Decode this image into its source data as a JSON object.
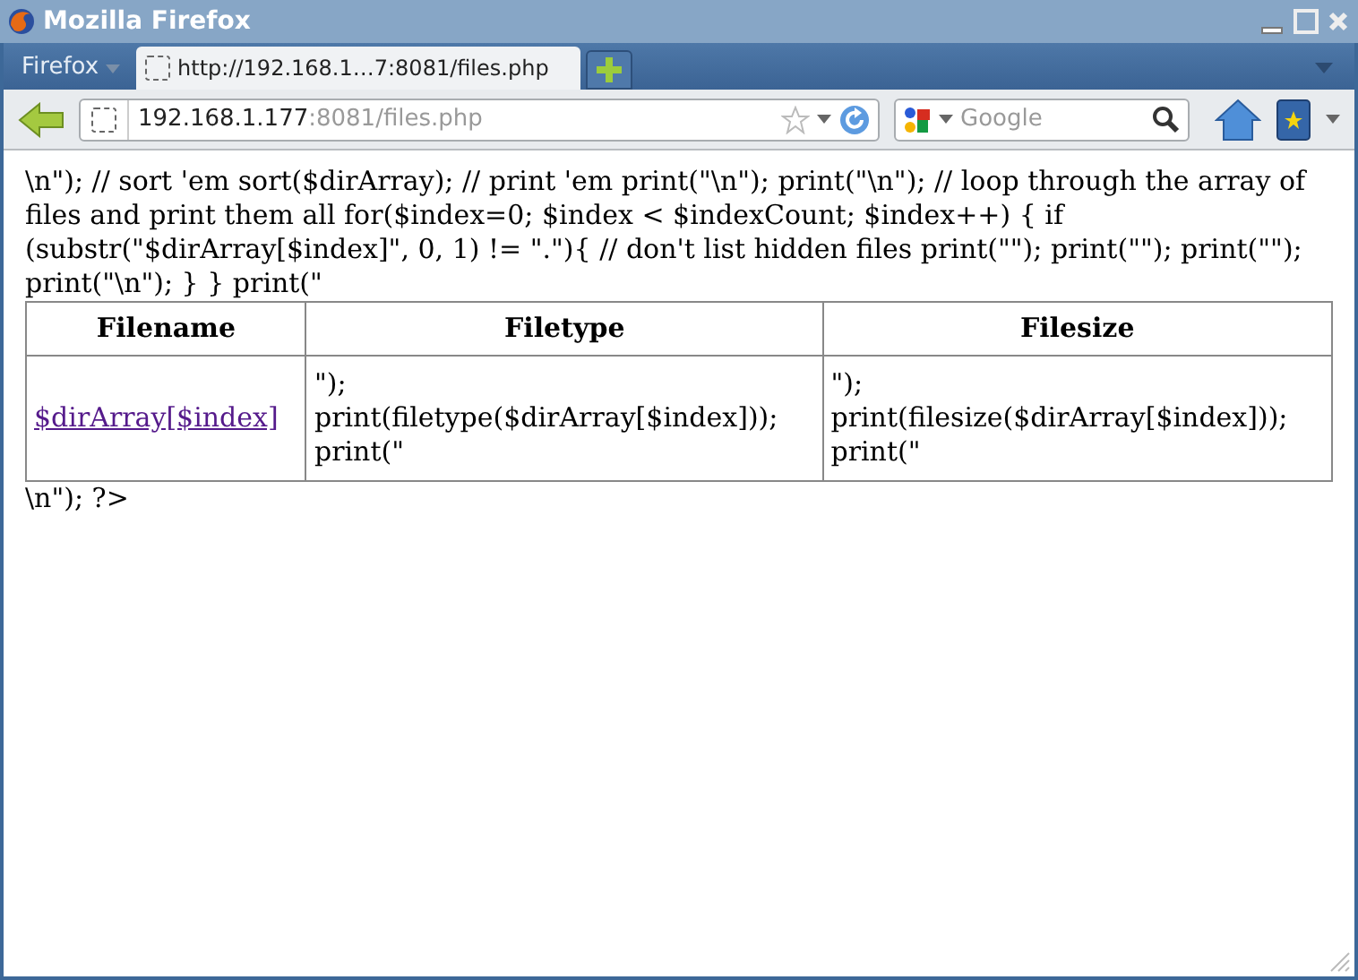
{
  "window": {
    "title": "Mozilla Firefox"
  },
  "menu_button": {
    "label": "Firefox"
  },
  "tabs": [
    {
      "label": "http://192.168.1…7:8081/files.php",
      "selected": true
    }
  ],
  "address_bar": {
    "host": "192.168.1.177",
    "path": ":8081/files.php"
  },
  "search": {
    "placeholder": "Google"
  },
  "page": {
    "intro": "\\n\"); // sort 'em sort($dirArray); // print 'em print(\"\\n\"); print(\"\\n\"); // loop through the array of files and print them all for($index=0; $index < $indexCount; $index++) { if (substr(\"$dirArray[$index]\", 0, 1) != \".\"){ // don't list hidden files print(\"\"); print(\"\"); print(\"\"); print(\"\\n\"); } } print(\"",
    "table": {
      "columns": [
        "Filename",
        "Filetype",
        "Filesize"
      ],
      "rows": [
        [
          "$dirArray[$index]",
          "\");\nprint(filetype($dirArray[$index]));\nprint(\"",
          "\");\nprint(filesize($dirArray[$index]));\nprint(\""
        ]
      ]
    },
    "outro": "\\n\"); ?>"
  }
}
